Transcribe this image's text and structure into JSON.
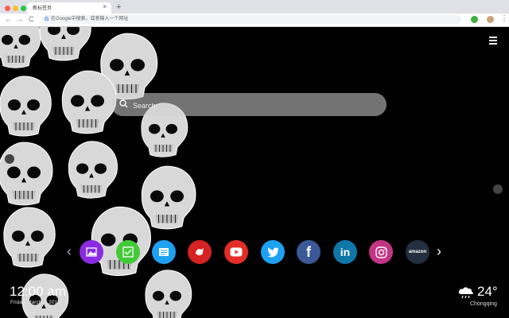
{
  "browser": {
    "tab_title": "新标签页",
    "tab_close": "×",
    "new_tab": "+",
    "back": "←",
    "forward": "→",
    "reload": "C",
    "omnibox_icon": "G",
    "omnibox_placeholder": "在Google中搜索，或者输入一个网址",
    "menu": "⋮"
  },
  "page": {
    "search_placeholder": "Search",
    "shortcuts": [
      {
        "name": "gallery",
        "color": "#8a2be2",
        "icon": "image-icon"
      },
      {
        "name": "tasks",
        "color": "#44c93a",
        "icon": "checklist-icon"
      },
      {
        "name": "news",
        "color": "#1da1f2",
        "icon": "news-icon"
      },
      {
        "name": "game",
        "color": "#d62222",
        "icon": "game-icon"
      },
      {
        "name": "youtube",
        "color": "#e52d27",
        "icon": "youtube-icon"
      },
      {
        "name": "twitter",
        "color": "#1da1f2",
        "icon": "twitter-icon"
      },
      {
        "name": "facebook",
        "color": "#3b5998",
        "icon": "facebook-icon"
      },
      {
        "name": "linkedin",
        "color": "#0e76a8",
        "icon": "linkedin-icon"
      },
      {
        "name": "instagram",
        "color": "#c13584",
        "icon": "instagram-icon"
      },
      {
        "name": "amazon",
        "color": "#232f3e",
        "icon": "amazon-icon"
      }
    ],
    "facebook_letter": "f",
    "linkedin_letters": "in",
    "amazon_label": "amazon",
    "left_arrow": "‹",
    "right_arrow": "›",
    "clock": "12:00 am",
    "date": "Friday, March 8, 2019",
    "temperature": "24°",
    "city": "Chongqing"
  },
  "colors": {
    "background": "#000000",
    "search_bg": "rgba(210,210,210,0.55)"
  }
}
